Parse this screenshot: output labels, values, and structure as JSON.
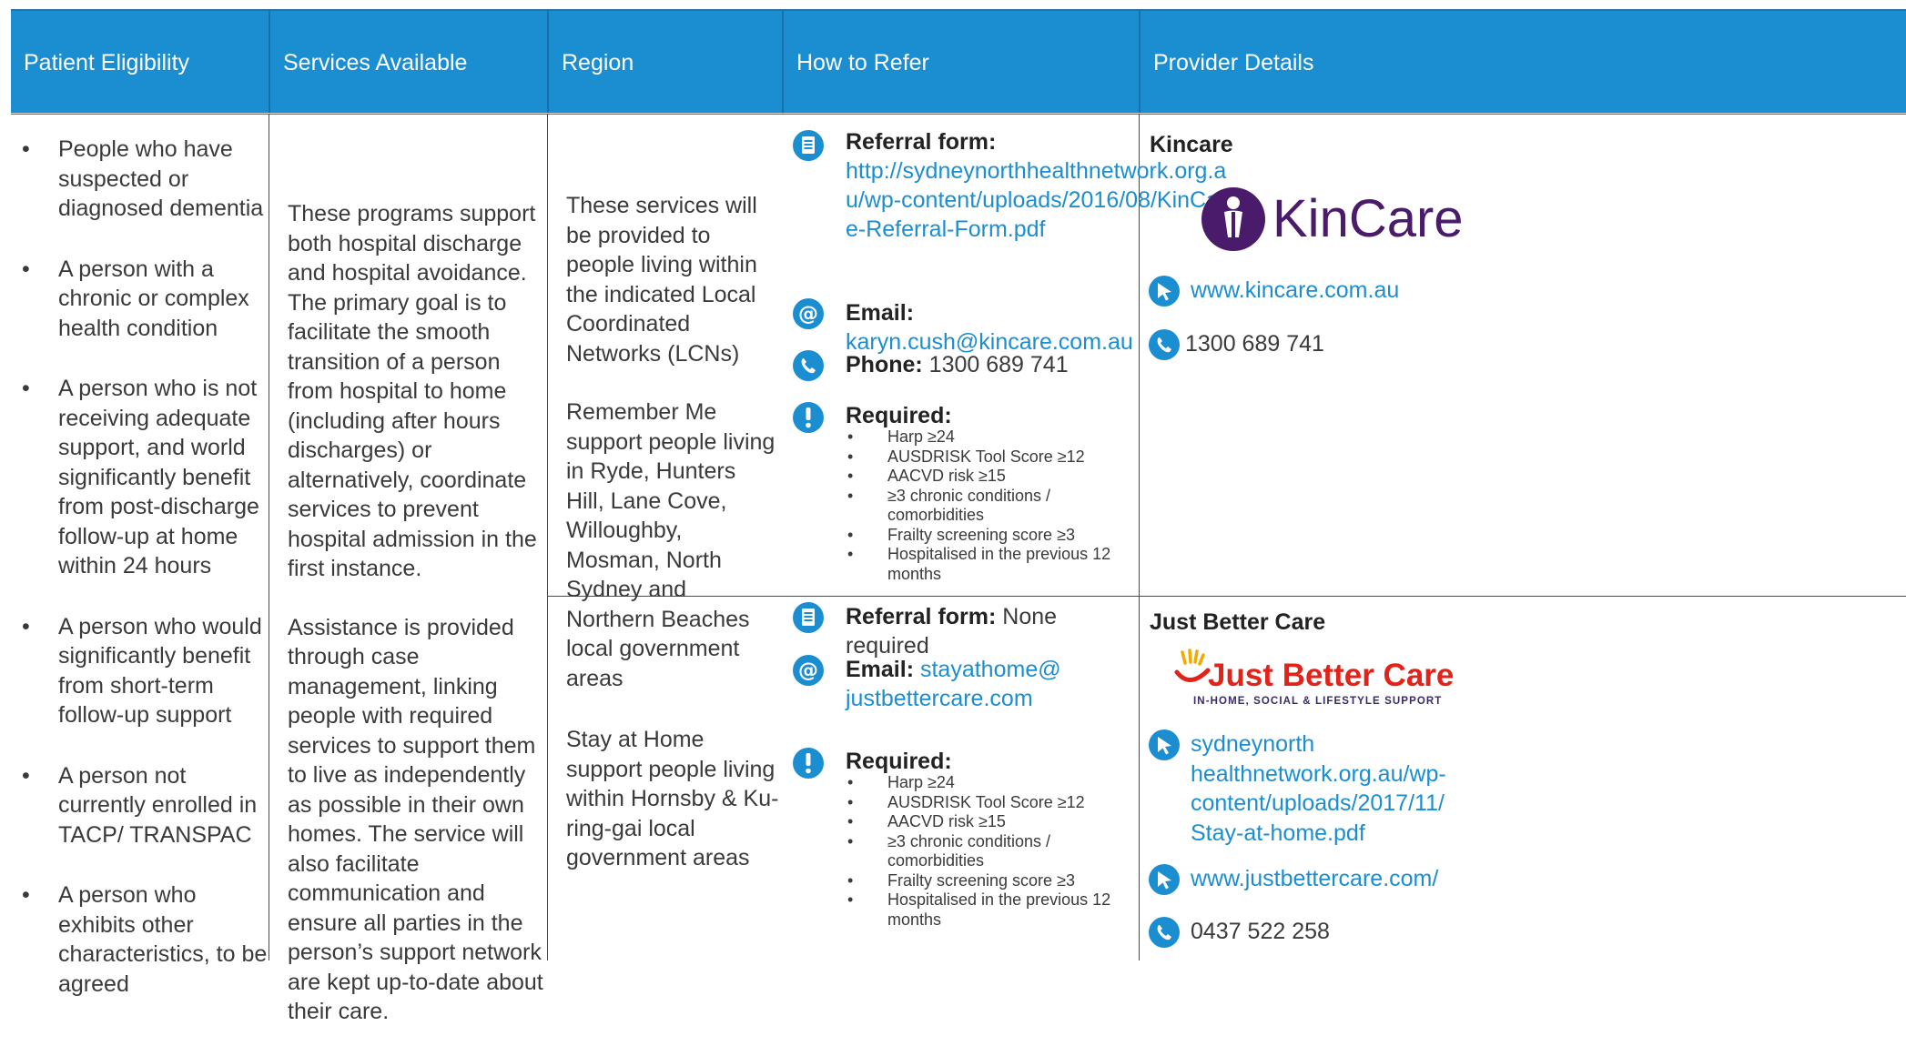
{
  "header": {
    "col1": "Patient Eligibility",
    "col2": "Services Available",
    "col3": "Region",
    "col4": "How to Refer",
    "col5": "Provider Details"
  },
  "eligibility": [
    "People who have suspected or diagnosed dementia",
    "A person with a chronic or complex health condition",
    "A person who is not receiving adequate support, and world significantly benefit from post-discharge follow-up at home within 24 hours",
    "A person who would significantly benefit from short-term follow-up support",
    "A person not currently enrolled in TACP/ TRANSPAC",
    "A person who exhibits other characteristics, to be agreed"
  ],
  "services": {
    "p1": "These programs support both hospital discharge and hospital avoidance. The primary goal is to facilitate the smooth transition of a person from hospital to home (including after hours discharges)  or alternatively, coordinate services to prevent hospital admission in the first instance.",
    "p2": "Assistance is provided through case management, linking people with required services to support them to live as independently as possible in their own homes. The service will also facilitate communication and ensure all parties in the person’s support network are kept up-to-date about their care."
  },
  "region": {
    "r1_p1": "These services will be provided to people living within the indicated Local Coordinated Networks (LCNs)",
    "r1_p2": "Remember Me support people living in Ryde, Hunters Hill, Lane Cove, Willoughby, Mosman, North Sydney and Northern Beaches local government areas",
    "r2": "Stay at Home support people living within Hornsby & Ku-ring-gai local government areas"
  },
  "refer1": {
    "form_label": "Referral form:",
    "form_value": "http://sydneynorthhealthnetwork.org.au/wp-content/uploads/2016/08/KinCare-Referral-Form.pdf",
    "email_label": "Email:",
    "email_value": "karyn.cush@kincare.com.au",
    "phone_label": "Phone:",
    "phone_value": "1300 689 741",
    "required_label": "Required:",
    "required": [
      "Harp ≥24",
      "AUSDRISK Tool Score ≥12",
      "AACVD risk ≥15",
      "≥3 chronic conditions / comorbidities",
      "Frailty screening score ≥3",
      "Hospitalised in the previous 12 months"
    ]
  },
  "refer2": {
    "form_label": "Referral form:",
    "form_value": "None required",
    "email_label": "Email:",
    "email_value": "stayathome@ justbettercare.com",
    "required_label": "Required:",
    "required": [
      "Harp ≥24",
      "AUSDRISK Tool Score ≥12",
      "AACVD risk ≥15",
      "≥3 chronic conditions / comorbidities",
      "Frailty screening score ≥3",
      "Hospitalised in the previous 12 months"
    ]
  },
  "provider1": {
    "name": "Kincare",
    "logo_text": "KinCare",
    "website": "www.kincare.com.au",
    "phone": "1300 689 741"
  },
  "provider2": {
    "name": "Just Better Care",
    "logo_text": "Just Better Care",
    "logo_tagline": "IN-HOME, SOCIAL & LIFESTYLE SUPPORT",
    "form_link": "sydneynorth healthnetwork.org.au/wp-content/uploads/2017/11/ Stay-at-home.pdf",
    "website": "www.justbettercare.com/",
    "phone": "0437 522 258"
  },
  "colors": {
    "header_bg": "#1b8ed2",
    "link": "#1b8ed2",
    "jbc_red": "#e2231a",
    "kincare_purple": "#4b1b6b"
  },
  "icons": [
    "document-icon",
    "at-icon",
    "phone-icon",
    "exclamation-icon",
    "cursor-icon"
  ]
}
